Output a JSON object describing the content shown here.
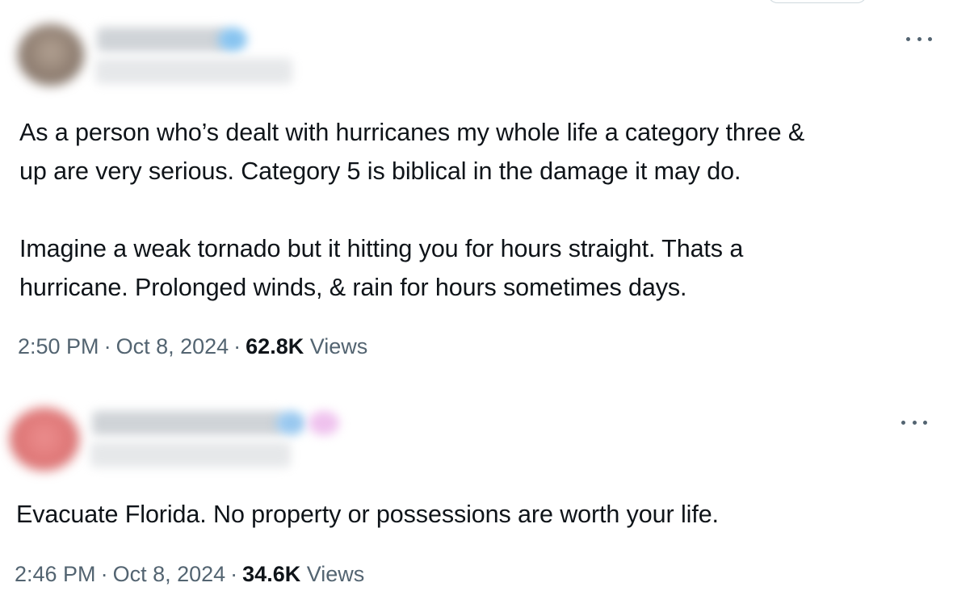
{
  "tweets": [
    {
      "text": [
        "As a person who’s dealt with hurricanes my whole life a category three &",
        "up are very serious. Category 5 is biblical in the damage it may do.",
        "Imagine a weak tornado but it hitting you for hours straight. Thats a",
        "hurricane. Prolonged winds, & rain for hours sometimes days."
      ],
      "time": "2:50 PM",
      "date": "Oct 8, 2024",
      "views_count": "62.8K",
      "views_label": "Views",
      "separator": "·"
    },
    {
      "text": [
        "Evacuate Florida. No property or possessions are worth your life."
      ],
      "time": "2:46 PM",
      "date": "Oct 8, 2024",
      "views_count": "34.6K",
      "views_label": "Views",
      "separator": "·"
    }
  ],
  "icons": {
    "more": "more-horizontal-icon",
    "verified": "verified-badge-icon"
  },
  "colors": {
    "text_primary": "#0f1419",
    "text_secondary": "#536471",
    "verified_blue": "#1d9bf0"
  }
}
